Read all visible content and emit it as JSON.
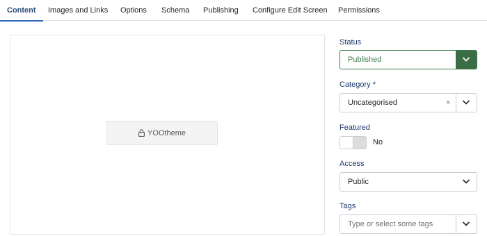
{
  "tabs": [
    {
      "label": "Content",
      "active": true
    },
    {
      "label": "Images and Links"
    },
    {
      "label": "Options"
    },
    {
      "label": "Schema"
    },
    {
      "label": "Publishing"
    },
    {
      "label": "Configure Edit Screen"
    },
    {
      "label": "Permissions"
    }
  ],
  "editor": {
    "builder_button_label": "YOOtheme",
    "builder_button_icon": "lock-icon"
  },
  "form": {
    "status": {
      "label": "Status",
      "value": "Published",
      "color": "#3c7a4a"
    },
    "category": {
      "label": "Category *",
      "value": "Uncategorised",
      "clear_symbol": "×"
    },
    "featured": {
      "label": "Featured",
      "value": "No"
    },
    "access": {
      "label": "Access",
      "value": "Public"
    },
    "tags": {
      "label": "Tags",
      "placeholder": "Type or select some tags"
    }
  },
  "colors": {
    "accent": "#2a69b8",
    "label_text": "#1a3867",
    "status_green": "#3b6d45"
  }
}
